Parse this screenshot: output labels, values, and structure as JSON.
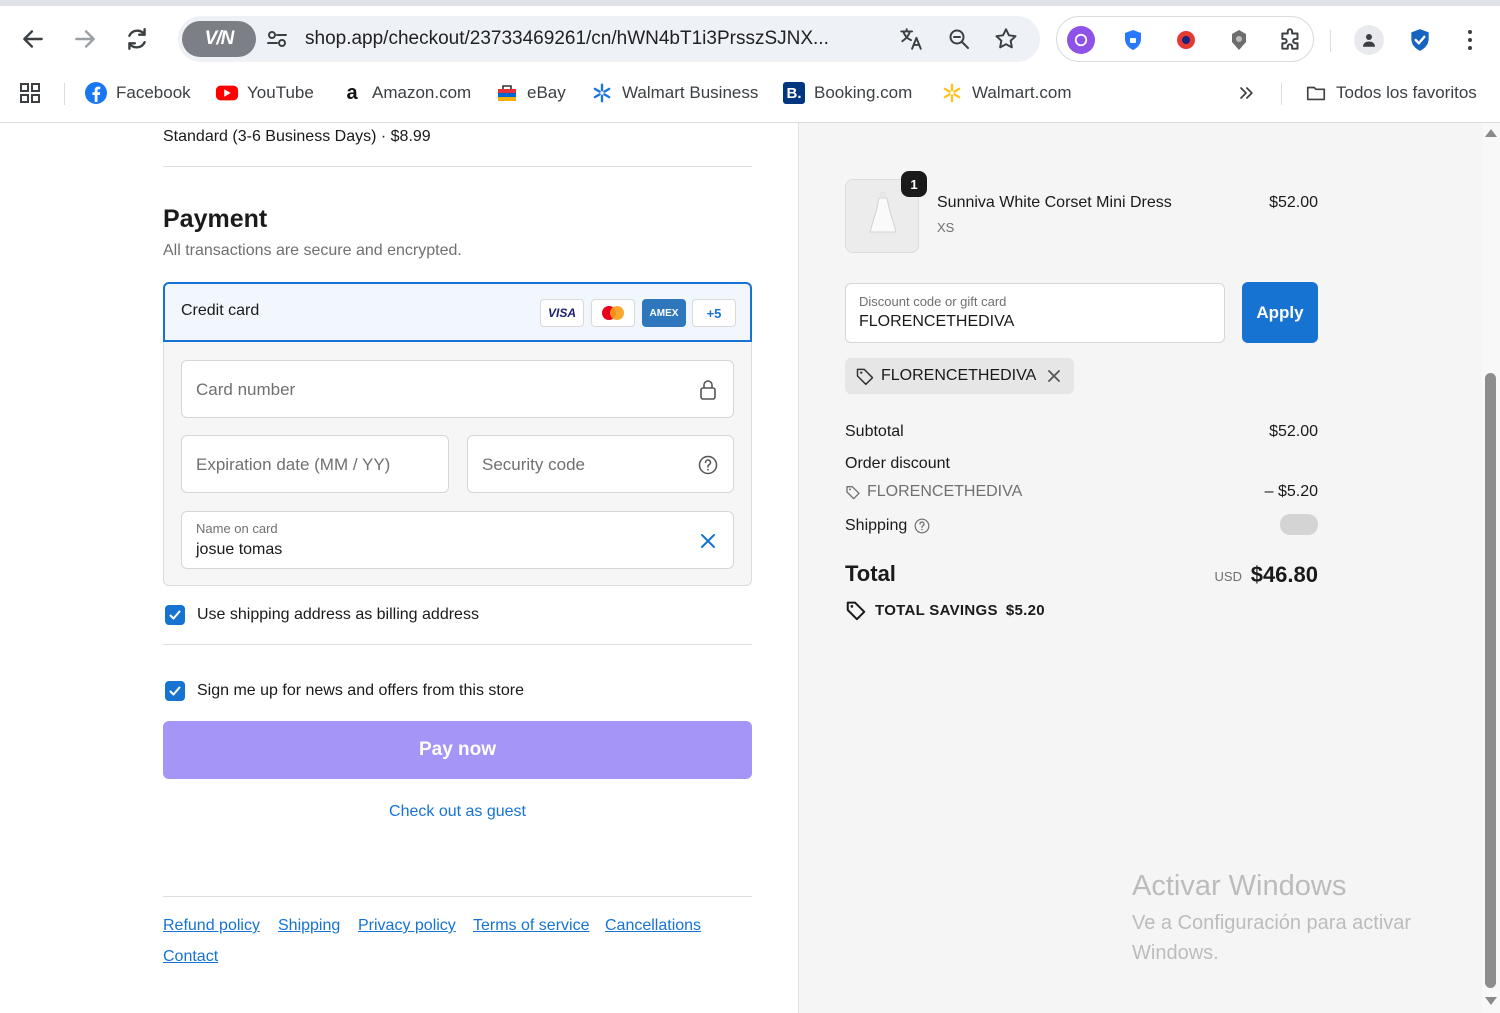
{
  "browser": {
    "url": "shop.app/checkout/23733469261/cn/hWN4bT1i3PrsszSJNX...",
    "vpn_label": "V/N",
    "bookmarks": [
      {
        "label": "Facebook",
        "icon": "facebook-icon"
      },
      {
        "label": "YouTube",
        "icon": "youtube-icon"
      },
      {
        "label": "Amazon.com",
        "icon": "amazon-icon"
      },
      {
        "label": "eBay",
        "icon": "ebay-icon"
      },
      {
        "label": "Walmart Business",
        "icon": "walmart-business-icon"
      },
      {
        "label": "Booking.com",
        "icon": "booking-icon"
      },
      {
        "label": "Walmart.com",
        "icon": "walmart-icon"
      }
    ],
    "all_bookmarks_label": "Todos los favoritos"
  },
  "checkout": {
    "shipping_method": "Standard (3-6 Business Days) · $8.99",
    "payment": {
      "title": "Payment",
      "subtitle": "All transactions are secure and encrypted.",
      "method_label": "Credit card",
      "card_badges": [
        "VISA",
        "Mastercard",
        "AMEX",
        "+5"
      ],
      "card_number_placeholder": "Card number",
      "expiration_placeholder": "Expiration date (MM / YY)",
      "security_code_placeholder": "Security code",
      "name_label": "Name on card",
      "name_value": "josue tomas"
    },
    "billing_checkbox": {
      "label": "Use shipping address as billing address",
      "checked": true
    },
    "newsletter_checkbox": {
      "label": "Sign me up for news and offers from this store",
      "checked": true
    },
    "pay_button": "Pay now",
    "guest_link": "Check out as guest",
    "footer_links": [
      "Refund policy",
      "Shipping",
      "Privacy policy",
      "Terms of service",
      "Cancellations",
      "Contact"
    ]
  },
  "summary": {
    "item": {
      "name": "Sunniva White Corset Mini Dress",
      "variant": "XS",
      "price": "$52.00",
      "quantity": "1"
    },
    "discount_field_label": "Discount code or gift card",
    "discount_field_value": "FLORENCETHEDIVA",
    "apply_button": "Apply",
    "applied_code": "FLORENCETHEDIVA",
    "subtotal_label": "Subtotal",
    "subtotal_value": "$52.00",
    "order_discount_label": "Order discount",
    "discount_code": "FLORENCETHEDIVA",
    "discount_value": "– $5.20",
    "shipping_label": "Shipping",
    "total_label": "Total",
    "currency": "USD",
    "total_value": "$46.80",
    "savings_label": "TOTAL SAVINGS",
    "savings_value": "$5.20"
  },
  "watermark": {
    "line1": "Activar Windows",
    "line2": "Ve a Configuración para activar Windows."
  },
  "colors": {
    "accent": "#1773d2",
    "pay_button": "#a495f6",
    "summary_bg": "#f5f5f5"
  }
}
